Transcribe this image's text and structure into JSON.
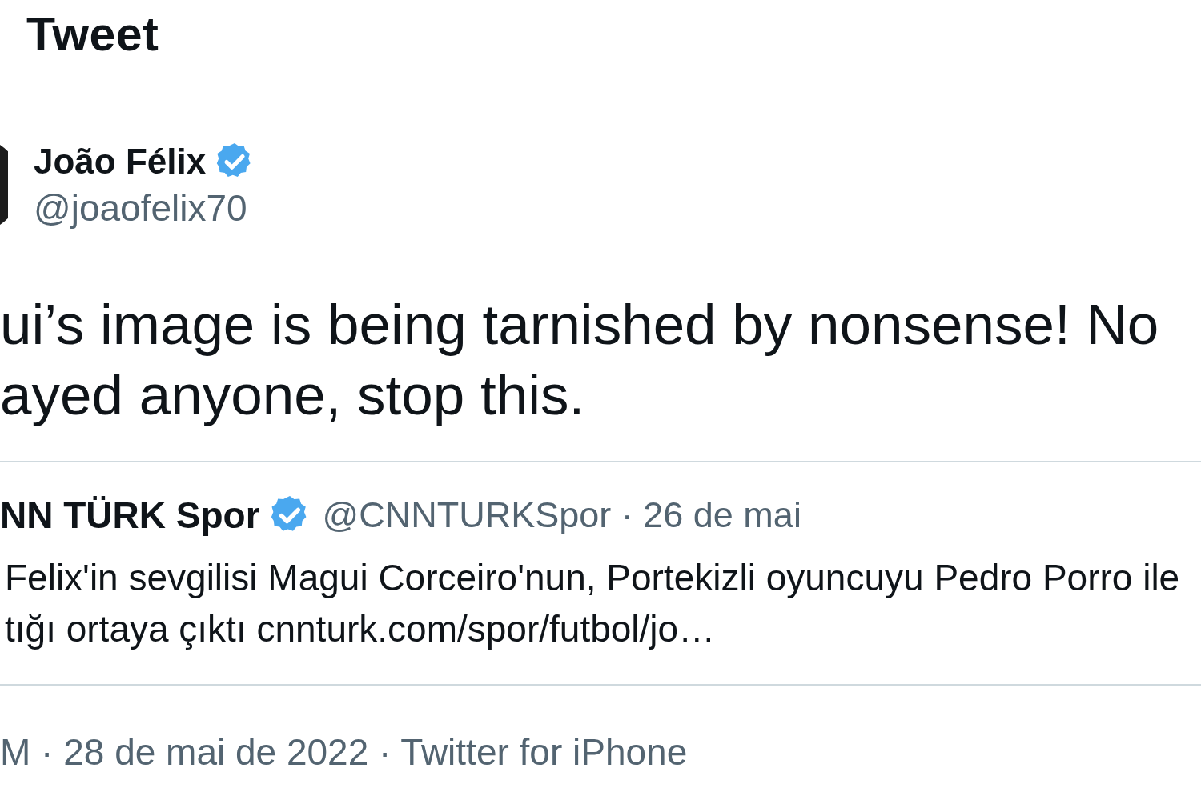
{
  "header": {
    "title": "Tweet"
  },
  "tweet": {
    "author": {
      "name": "João Félix",
      "verified": true,
      "handle": "@joaofelix70"
    },
    "text_lines": [
      "ui’s image is being tarnished by nonsense! No",
      "ayed anyone, stop this."
    ],
    "quote": {
      "author": {
        "name": "NN TÜRK Spor",
        "verified": true
      },
      "meta": "@CNNTURKSpor · 26 de mai",
      "text_lines": [
        "Felix'in sevgilisi Magui Corceiro'nun, Portekizli oyuncuyu Pedro Porro ile",
        "tığı ortaya çıktı cnnturk.com/spor/futbol/jo…"
      ]
    },
    "footer": {
      "meta": "M · 28 de mai de 2022 · Twitter for iPhone"
    }
  }
}
